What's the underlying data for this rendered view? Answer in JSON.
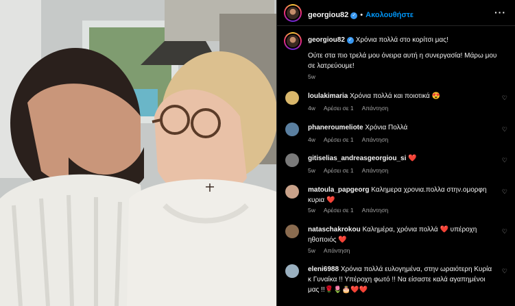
{
  "header": {
    "username": "georgiou82",
    "follow_label": "Ακολουθήστε",
    "more_icon": "more-horizontal-icon"
  },
  "caption": {
    "username": "georgiou82",
    "line1": "Χρόνια πολλά στο κορίτσι μας!",
    "line2": "Ούτε στα πιο τρελά μου όνειρα αυτή η συνεργασία! Μάρω μου",
    "line3": "σε λατρεύουμε!",
    "time": "5w"
  },
  "comments": [
    {
      "username": "loulakimaria",
      "text": "Χρόνια πολλά και ποιοτικά 😍",
      "time": "4w",
      "likes": "Αρέσει σε 1",
      "reply": "Απάντηση",
      "avatar_color": "#d9b76b"
    },
    {
      "username": "phaneroumeliote",
      "text": "Χρόνια Πολλά",
      "time": "4w",
      "likes": "Αρέσει σε 1",
      "reply": "Απάντηση",
      "avatar_color": "#5a7fa0"
    },
    {
      "username": "gitiselias_andreasgeorgiou_si",
      "text": "❤️",
      "time": "5w",
      "likes": "Αρέσει σε 1",
      "reply": "Απάντηση",
      "avatar_color": "#7a7a7a"
    },
    {
      "username": "matoula_papgeorg",
      "text": "Καλημερα χρονια.πολλα στην.ομορφη",
      "text2": "κυρια ❤️",
      "time": "5w",
      "likes": "Αρέσει σε 1",
      "reply": "Απάντηση",
      "avatar_color": "#c9a28a"
    },
    {
      "username": "nataschakrokou",
      "text": "Καλημέρα, χρόνια πολλά ❤️ υπέροχη",
      "text2": "ηθοποιός ❤️",
      "time": "5w",
      "likes": "",
      "reply": "Απάντηση",
      "avatar_color": "#8a6b4f"
    },
    {
      "username": "eleni6988",
      "text": "Χρόνια πολλά ευλογημένα, στην ωραιότερη Κυρία",
      "text2": "κ Γυναίκα !! Υπέροχη φωτό !! Να είσαστε καλά αγαπημένοι",
      "text3": "μας !!🌹🌷🎂❤️❤️",
      "time": "",
      "likes": "",
      "reply": "",
      "avatar_color": "#9ab0c0"
    }
  ],
  "icons": {
    "heart": "heart-icon",
    "verified": "verified-badge-icon"
  },
  "colors": {
    "accent": "#0095f6",
    "verified": "#3897f0",
    "heart_red": "#ff3040",
    "meta": "#a8a8a8"
  }
}
